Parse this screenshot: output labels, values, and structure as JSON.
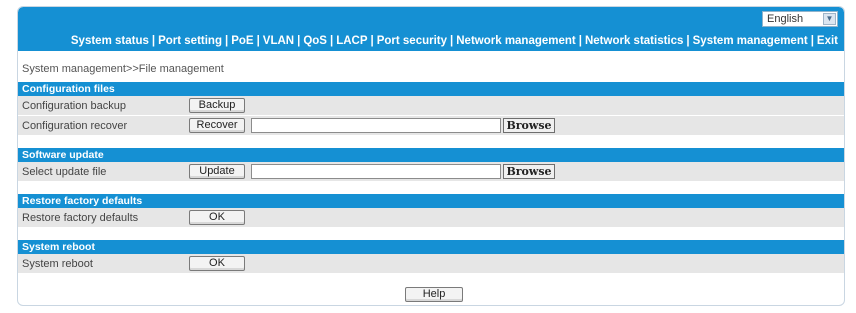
{
  "header": {
    "language": "English",
    "nav": [
      "System status",
      "Port setting",
      "PoE",
      "VLAN",
      "QoS",
      "LACP",
      "Port security",
      "Network management",
      "Network statistics",
      "System management",
      "Exit"
    ],
    "separator": "|"
  },
  "breadcrumb": "System management>>File management",
  "sections": {
    "config": {
      "title": "Configuration files",
      "backup_label": "Configuration backup",
      "backup_button": "Backup",
      "recover_label": "Configuration recover",
      "recover_button": "Recover",
      "recover_file_value": "",
      "browse_button": "Browse"
    },
    "software": {
      "title": "Software update",
      "select_label": "Select update file",
      "update_button": "Update",
      "file_value": "",
      "browse_button": "Browse"
    },
    "factory": {
      "title": "Restore factory defaults",
      "label": "Restore factory defaults",
      "ok_button": "OK"
    },
    "reboot": {
      "title": "System reboot",
      "label": "System reboot",
      "ok_button": "OK"
    }
  },
  "help_button": "Help",
  "colors": {
    "header_blue": "#1590d3",
    "row_gray": "#e6e6e6"
  }
}
